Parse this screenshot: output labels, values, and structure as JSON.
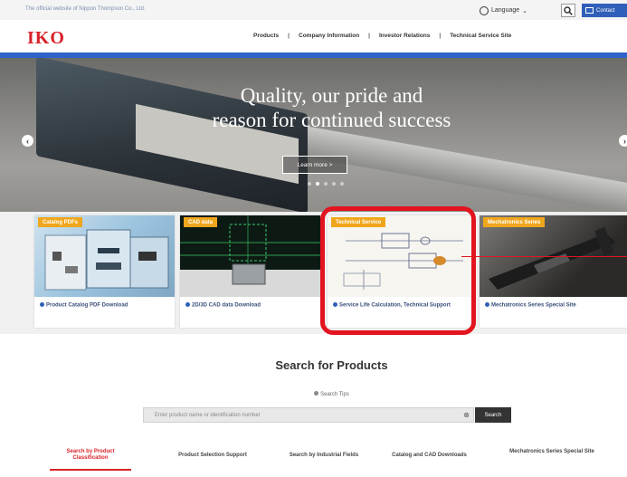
{
  "topbar": {
    "tagline": "The official website of Nippon Thompson Co., Ltd.",
    "language_label": "Language",
    "contact_label": "Contact"
  },
  "header": {
    "logo": "IKO",
    "nav": [
      {
        "label": "Products"
      },
      {
        "label": "Company Information"
      },
      {
        "label": "Investor Relations"
      },
      {
        "label": "Technical Service Site"
      }
    ]
  },
  "hero": {
    "headline_line1": "Quality, our pride and",
    "headline_line2": "reason for continued success",
    "button_label": "Learn more >",
    "slide_count": 5,
    "active_slide": 2
  },
  "cards": [
    {
      "tag": "Catalog PDFs",
      "caption": "Product Catalog PDF Download"
    },
    {
      "tag": "CAD data",
      "caption": "2D/3D CAD data Download"
    },
    {
      "tag": "Technical Service",
      "caption": "Service Life Calculation, Technical Support"
    },
    {
      "tag": "Mechatronics Series",
      "caption": "Mechatronics Series Special Site"
    }
  ],
  "search": {
    "title": "Search for Products",
    "tips_label": "Search Tips",
    "placeholder": "Enter product name or identification number",
    "clear_symbol": "⊗",
    "submit_label": "Search"
  },
  "tabs": [
    {
      "label": "Search by Product Classification",
      "active": true
    },
    {
      "label": "Product Selection Support",
      "active": false
    },
    {
      "label": "Search by Industrial Fields",
      "active": false
    },
    {
      "label": "Catalog and CAD Downloads",
      "active": false
    },
    {
      "label": "Mechatronics Series Special Site",
      "active": false
    }
  ],
  "colors": {
    "brand_red": "#d8232a",
    "nav_blue": "#2d63c8",
    "tag_orange": "#f0a61c",
    "highlight_red": "#e2141f"
  }
}
